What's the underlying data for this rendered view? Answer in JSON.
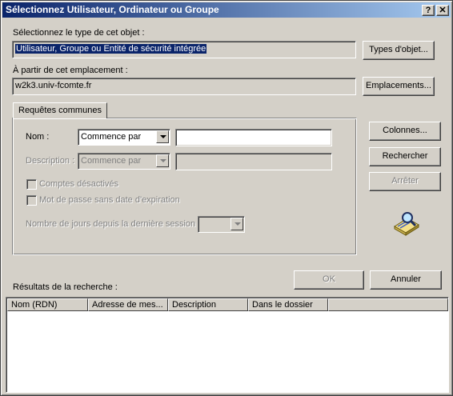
{
  "window": {
    "title": "Sélectionnez Utilisateur, Ordinateur ou Groupe",
    "help_label": "?",
    "close_label": "✕"
  },
  "object_type": {
    "label": "Sélectionnez le type de cet objet :",
    "value": "Utilisateur, Groupe ou Entité de sécurité intégrée",
    "button": "Types d'objet..."
  },
  "location": {
    "label": "À partir de cet emplacement :",
    "value": "w2k3.univ-fcomte.fr",
    "button": "Emplacements..."
  },
  "tab": {
    "label": "Requêtes communes"
  },
  "query": {
    "name_label": "Nom :",
    "name_mode": "Commence par",
    "name_value": "",
    "desc_label": "Description :",
    "desc_mode": "Commence par",
    "desc_value": "",
    "disabled_accounts": "Comptes désactivés",
    "no_expire_pwd": "Mot de passe sans date d'expiration",
    "days_label": "Nombre de jours depuis la dernière session :",
    "days_value": ""
  },
  "side_buttons": {
    "columns": "Colonnes...",
    "search": "Rechercher",
    "stop": "Arrêter"
  },
  "footer": {
    "ok": "OK",
    "cancel": "Annuler"
  },
  "results": {
    "label": "Résultats de la recherche :",
    "columns": [
      "Nom (RDN)",
      "Adresse de mes...",
      "Description",
      "Dans le dossier"
    ]
  }
}
